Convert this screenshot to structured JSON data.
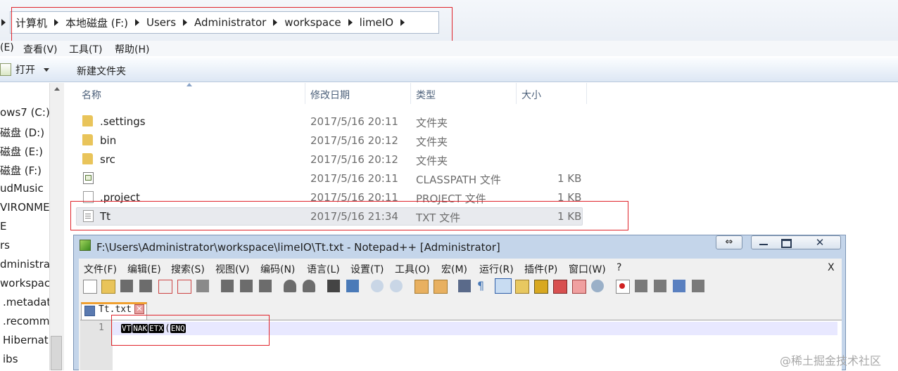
{
  "address_bar": {
    "crumbs": [
      "计算机",
      "本地磁盘 (F:)",
      "Users",
      "Administrator",
      "workspace",
      "limeIO"
    ]
  },
  "menu_bar": {
    "edit": "(E)",
    "view": "查看(V)",
    "tools": "工具(T)",
    "help": "帮助(H)"
  },
  "command_bar": {
    "open": "打开",
    "new_folder": "新建文件夹"
  },
  "nav_pane": {
    "items": [
      "ows7 (C:)",
      "磁盘 (D:)",
      "磁盘 (E:)",
      "磁盘 (F:)",
      "udMusic",
      "VIRONMEN",
      "E",
      "rs",
      "dministrat",
      "workspace",
      ".metadat",
      ".recomm",
      "Hibernat",
      "ibs"
    ]
  },
  "file_list": {
    "columns": [
      "名称",
      "修改日期",
      "类型",
      "大小"
    ],
    "rows": [
      {
        "name": ".settings",
        "date": "2017/5/16 20:11",
        "type": "文件夹",
        "size": "",
        "icon": "folder-icon"
      },
      {
        "name": "bin",
        "date": "2017/5/16 20:12",
        "type": "文件夹",
        "size": "",
        "icon": "folder-icon"
      },
      {
        "name": "src",
        "date": "2017/5/16 20:12",
        "type": "文件夹",
        "size": "",
        "icon": "folder-icon"
      },
      {
        "name": "",
        "date": "2017/5/16 20:11",
        "type": "CLASSPATH 文件",
        "size": "1 KB",
        "icon": "classpath-file-icon"
      },
      {
        "name": ".project",
        "date": "2017/5/16 20:11",
        "type": "PROJECT 文件",
        "size": "1 KB",
        "icon": "file-icon"
      },
      {
        "name": "Tt",
        "date": "2017/5/16 21:34",
        "type": "TXT 文件",
        "size": "1 KB",
        "icon": "text-file-icon",
        "selected": true
      }
    ]
  },
  "notepad": {
    "title": "F:\\Users\\Administrator\\workspace\\limeIO\\Tt.txt - Notepad++ [Administrator]",
    "menu": [
      "文件(F)",
      "编辑(E)",
      "搜索(S)",
      "视图(V)",
      "编码(N)",
      "语言(L)",
      "设置(T)",
      "工具(O)",
      "宏(M)",
      "运行(R)",
      "插件(P)",
      "窗口(W)",
      "?"
    ],
    "close_doc": "X",
    "tab": "Tt.txt",
    "line_number": "1",
    "content_tokens": [
      "VT",
      "NAK",
      "ETX"
    ],
    "content_plain": "(",
    "content_tail": "ENQ"
  },
  "watermark": "@稀土掘金技术社区",
  "colors": {
    "highlight_box": "#e0242b",
    "selected_row": "#e8eaee",
    "current_line": "#e8e8ff",
    "folder": "#e9c45a"
  }
}
